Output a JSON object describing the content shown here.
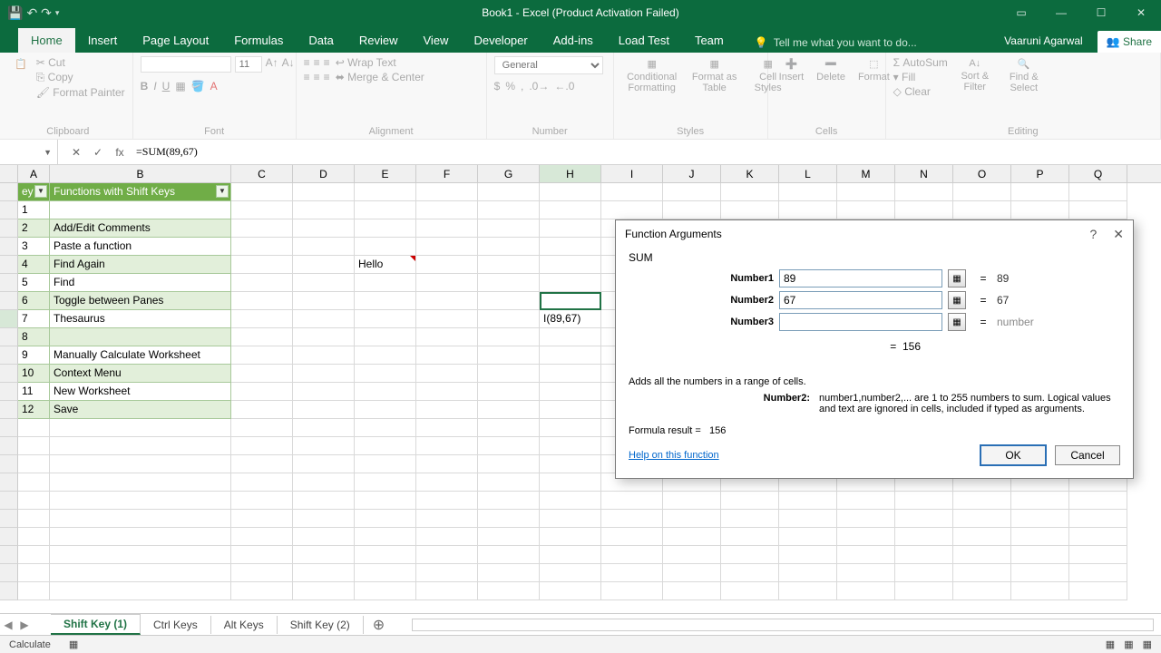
{
  "titlebar": {
    "title": "Book1 - Excel (Product Activation Failed)"
  },
  "ribbon_tabs": [
    "Home",
    "Insert",
    "Page Layout",
    "Formulas",
    "Data",
    "Review",
    "View",
    "Developer",
    "Add-ins",
    "Load Test",
    "Team"
  ],
  "active_tab": "Home",
  "tellme": "Tell me what you want to do...",
  "user": "Vaaruni Agarwal",
  "share": "Share",
  "clipboard": {
    "cut": "Cut",
    "copy": "Copy",
    "painter": "Format Painter",
    "title": "Clipboard"
  },
  "font": {
    "size": "11",
    "title": "Font"
  },
  "alignment": {
    "wrap": "Wrap Text",
    "merge": "Merge & Center",
    "title": "Alignment"
  },
  "number": {
    "format": "General",
    "title": "Number"
  },
  "styles": {
    "cf": "Conditional Formatting",
    "fat": "Format as Table",
    "cs": "Cell Styles",
    "title": "Styles"
  },
  "cells_grp": {
    "ins": "Insert",
    "del": "Delete",
    "fmt": "Format",
    "title": "Cells"
  },
  "editing": {
    "sum": "AutoSum",
    "fill": "Fill",
    "clear": "Clear",
    "sort": "Sort & Filter",
    "find": "Find & Select",
    "title": "Editing"
  },
  "formula_bar": {
    "fx": "fx",
    "value": "=SUM(89,67)"
  },
  "columns": [
    "A",
    "B",
    "C",
    "D",
    "E",
    "F",
    "G",
    "H",
    "I",
    "J",
    "K",
    "L",
    "M",
    "N",
    "O",
    "P",
    "Q"
  ],
  "table": {
    "hdrA": "ey",
    "hdrB": "Functions with Shift Keys",
    "rows": [
      {
        "a": "1",
        "b": ""
      },
      {
        "a": "2",
        "b": "Add/Edit Comments"
      },
      {
        "a": "3",
        "b": "Paste a function"
      },
      {
        "a": "4",
        "b": "Find Again"
      },
      {
        "a": "5",
        "b": "Find"
      },
      {
        "a": "6",
        "b": "Toggle between Panes"
      },
      {
        "a": "7",
        "b": "Thesaurus"
      },
      {
        "a": "8",
        "b": ""
      },
      {
        "a": "9",
        "b": "Manually Calculate Worksheet"
      },
      {
        "a": "10",
        "b": "Context Menu"
      },
      {
        "a": "11",
        "b": "New Worksheet"
      },
      {
        "a": "12",
        "b": "Save"
      }
    ]
  },
  "cell_E4": "Hello",
  "cell_H7": "I(89,67)",
  "dialog": {
    "title": "Function Arguments",
    "fn": "SUM",
    "args": [
      {
        "label": "Number1",
        "value": "89",
        "result": "89"
      },
      {
        "label": "Number2",
        "value": "67",
        "result": "67"
      },
      {
        "label": "Number3",
        "value": "",
        "result": "number"
      }
    ],
    "calc_eq": "=",
    "calc_result": "156",
    "desc": "Adds all the numbers in a range of cells.",
    "detail_key": "Number2:",
    "detail_val": "number1,number2,... are 1 to 255 numbers to sum. Logical values and text are ignored in cells, included if typed as arguments.",
    "formula_label": "Formula result =",
    "formula_result": "156",
    "help": "Help on this function",
    "ok": "OK",
    "cancel": "Cancel"
  },
  "sheets": [
    "Shift Key (1)",
    "Ctrl Keys",
    "Alt Keys",
    "Shift Key (2)"
  ],
  "active_sheet": 0,
  "status": {
    "mode": "Calculate"
  }
}
